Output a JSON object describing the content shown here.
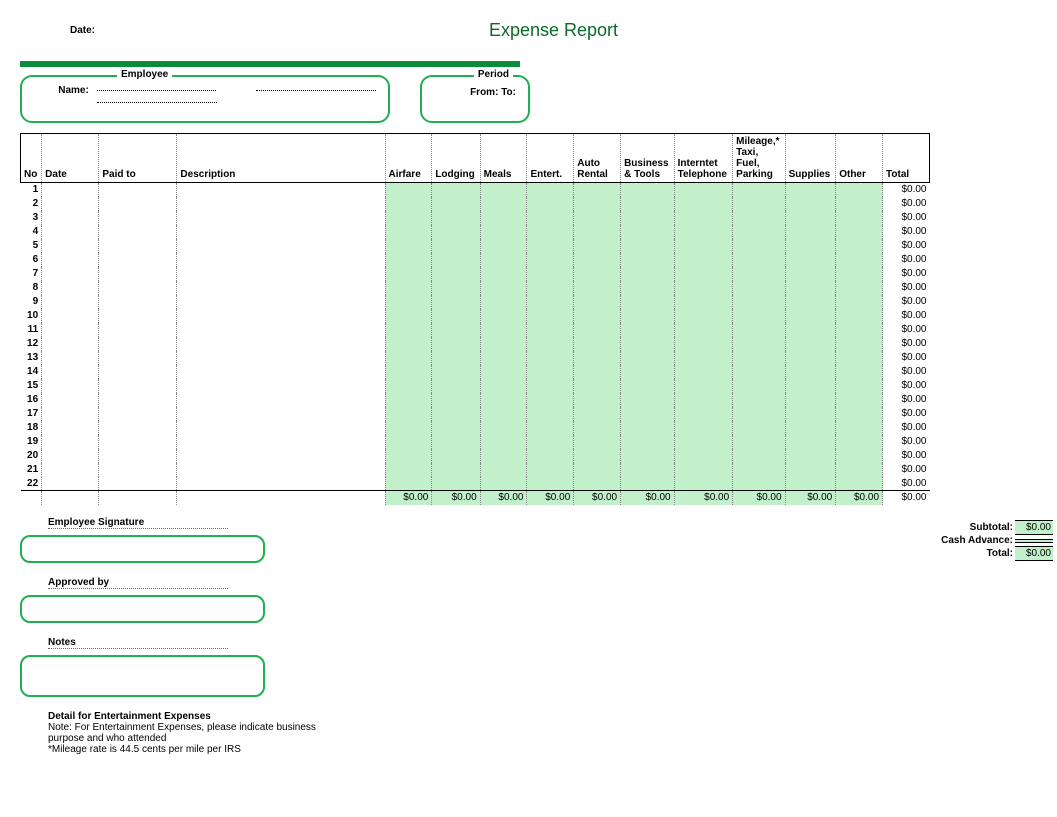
{
  "header": {
    "date_label": "Date:",
    "title": "Expense Report"
  },
  "employee": {
    "legend": "Employee",
    "name_label": "Name:"
  },
  "period": {
    "legend": "Period",
    "from_label": "From:",
    "to_label": "To:"
  },
  "columns": {
    "no": "No",
    "date": "Date",
    "paid_to": "Paid to",
    "description": "Description",
    "airfare": "Airfare",
    "lodging": "Lodging",
    "meals": "Meals",
    "entert": "Entert.",
    "auto_rental": "Auto Rental",
    "business_tools": "Business & Tools",
    "internet_telephone": "Interntet Telephone",
    "mileage": "Mileage,* Taxi, Fuel, Parking",
    "supplies": "Supplies",
    "other": "Other",
    "total": "Total"
  },
  "rows": [
    {
      "no": "1",
      "total": "$0.00"
    },
    {
      "no": "2",
      "total": "$0.00"
    },
    {
      "no": "3",
      "total": "$0.00"
    },
    {
      "no": "4",
      "total": "$0.00"
    },
    {
      "no": "5",
      "total": "$0.00"
    },
    {
      "no": "6",
      "total": "$0.00"
    },
    {
      "no": "7",
      "total": "$0.00"
    },
    {
      "no": "8",
      "total": "$0.00"
    },
    {
      "no": "9",
      "total": "$0.00"
    },
    {
      "no": "10",
      "total": "$0.00"
    },
    {
      "no": "11",
      "total": "$0.00"
    },
    {
      "no": "12",
      "total": "$0.00"
    },
    {
      "no": "13",
      "total": "$0.00"
    },
    {
      "no": "14",
      "total": "$0.00"
    },
    {
      "no": "15",
      "total": "$0.00"
    },
    {
      "no": "16",
      "total": "$0.00"
    },
    {
      "no": "17",
      "total": "$0.00"
    },
    {
      "no": "18",
      "total": "$0.00"
    },
    {
      "no": "19",
      "total": "$0.00"
    },
    {
      "no": "20",
      "total": "$0.00"
    },
    {
      "no": "21",
      "total": "$0.00"
    },
    {
      "no": "22",
      "total": "$0.00"
    }
  ],
  "column_totals": {
    "airfare": "$0.00",
    "lodging": "$0.00",
    "meals": "$0.00",
    "entert": "$0.00",
    "auto_rental": "$0.00",
    "business_tools": "$0.00",
    "internet_telephone": "$0.00",
    "mileage": "$0.00",
    "supplies": "$0.00",
    "other": "$0.00",
    "total": "$0.00"
  },
  "signature": {
    "employee_signature": "Employee Signature",
    "approved_by": "Approved by",
    "notes": "Notes"
  },
  "detail": {
    "heading": "Detail for Entertainment Expenses",
    "note1": "Note:  For Entertainment Expenses, please indicate business purpose and who attended",
    "note2": "*Mileage rate is 44.5 cents per mile per IRS"
  },
  "summary": {
    "subtotal_label": "Subtotal:",
    "subtotal_value": "$0.00",
    "cash_advance_label": "Cash Advance:",
    "total_label": "Total:",
    "total_value": "$0.00"
  }
}
